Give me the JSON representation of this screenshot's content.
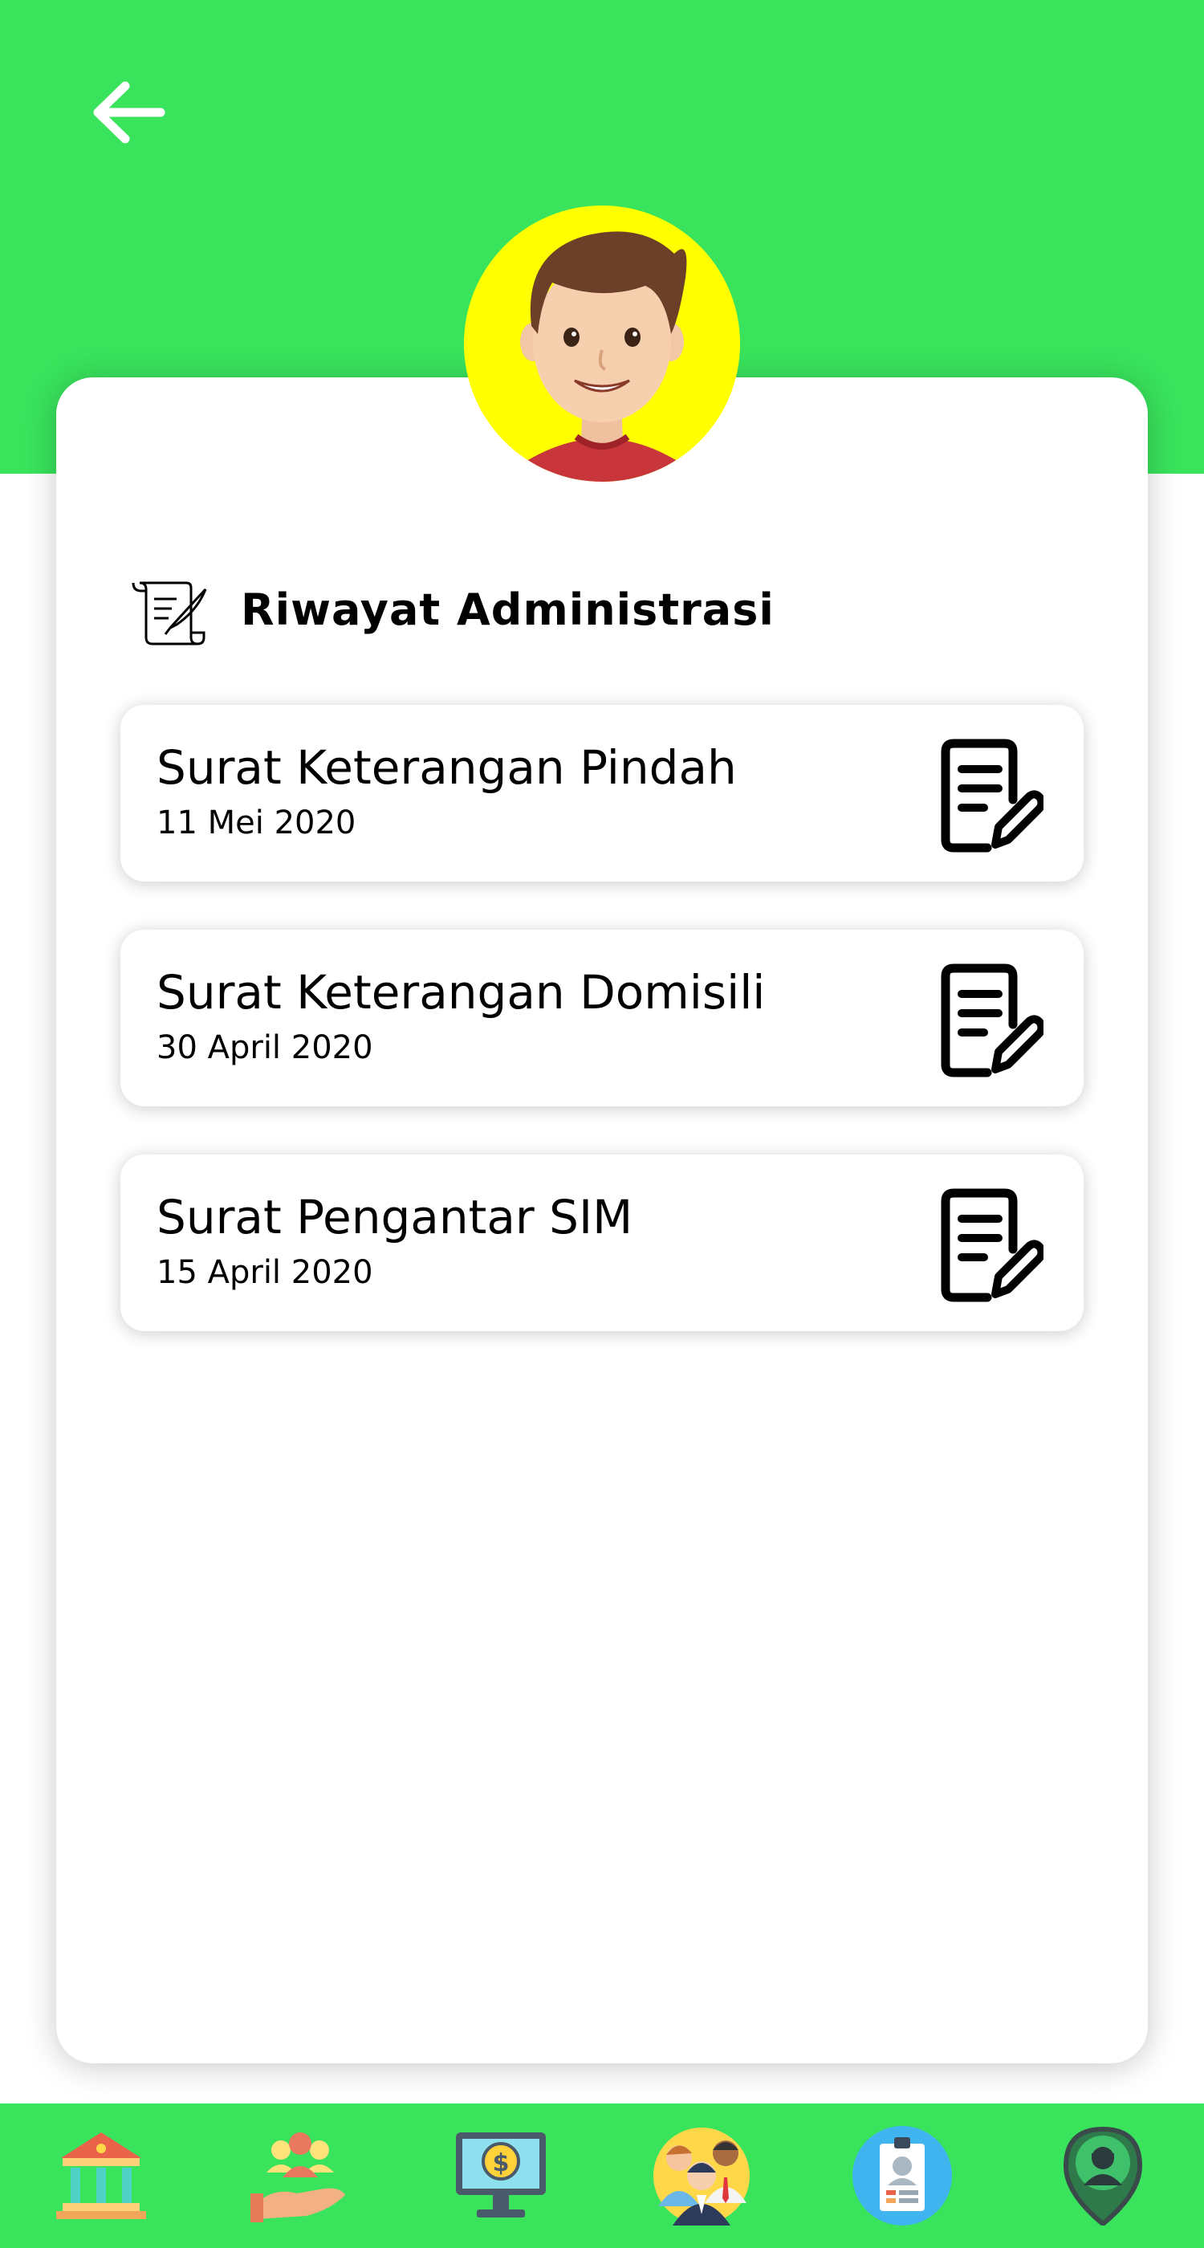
{
  "header": {
    "back_icon": "arrow-left-icon",
    "background_color": "#39e35c"
  },
  "profile": {
    "avatar_icon": "user-avatar-icon",
    "avatar_background": "#ffff00"
  },
  "section": {
    "icon": "scroll-quill-icon",
    "title": "Riwayat Administrasi"
  },
  "history": [
    {
      "title": "Surat Keterangan Pindah",
      "date": "11 Mei 2020",
      "icon": "document-edit-icon"
    },
    {
      "title": "Surat Keterangan Domisili",
      "date": "30 April 2020",
      "icon": "document-edit-icon"
    },
    {
      "title": "Surat Pengantar SIM",
      "date": "15 April 2020",
      "icon": "document-edit-icon"
    }
  ],
  "bottom_nav": {
    "items": [
      {
        "icon": "government-building-icon"
      },
      {
        "icon": "community-assistance-icon"
      },
      {
        "icon": "finance-monitor-icon"
      },
      {
        "icon": "people-group-icon"
      },
      {
        "icon": "id-card-icon"
      },
      {
        "icon": "location-person-icon"
      }
    ]
  }
}
